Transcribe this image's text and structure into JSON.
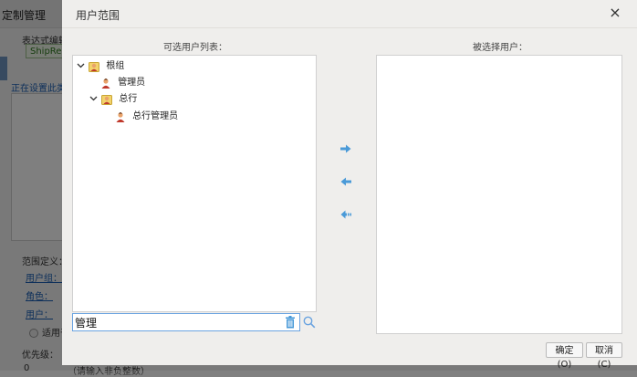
{
  "background": {
    "window_title": "定制管理",
    "expr_editor_label": "表达式编辑",
    "green_button": "ShipRe",
    "setting_text": "正在设置此类",
    "range_def_label": "范围定义：",
    "user_group_link": "用户组：",
    "role_link": "角色：",
    "user_link": "用户：",
    "apply_radio": "适用于",
    "priority_label": "优先级：",
    "priority_value": "0",
    "priority_hint": "（请输入非负整数）"
  },
  "dialog": {
    "title": "用户范围",
    "close_label": "×",
    "left_header": "可选用户列表：",
    "right_header": "被选择用户：",
    "tree": [
      {
        "label": "根组",
        "type": "group",
        "expanded": true,
        "level": 0
      },
      {
        "label": "管理员",
        "type": "user",
        "level": 1
      },
      {
        "label": "总行",
        "type": "group",
        "expanded": true,
        "level": 1
      },
      {
        "label": "总行管理员",
        "type": "user",
        "level": 2
      }
    ],
    "search": {
      "value": "管理",
      "placeholder": ""
    },
    "ok_label": "确定(O)",
    "cancel_label": "取消(C)"
  },
  "colors": {
    "arrow_blue": "#4a9ad8",
    "search_border": "#6aa3e0",
    "link_blue": "#1a5fb4"
  },
  "icons": [
    "chevron-down-icon",
    "user-group-icon",
    "user-icon",
    "arrow-right-icon",
    "arrow-left-icon",
    "double-arrow-left-icon",
    "trash-icon",
    "search-icon",
    "close-icon"
  ]
}
